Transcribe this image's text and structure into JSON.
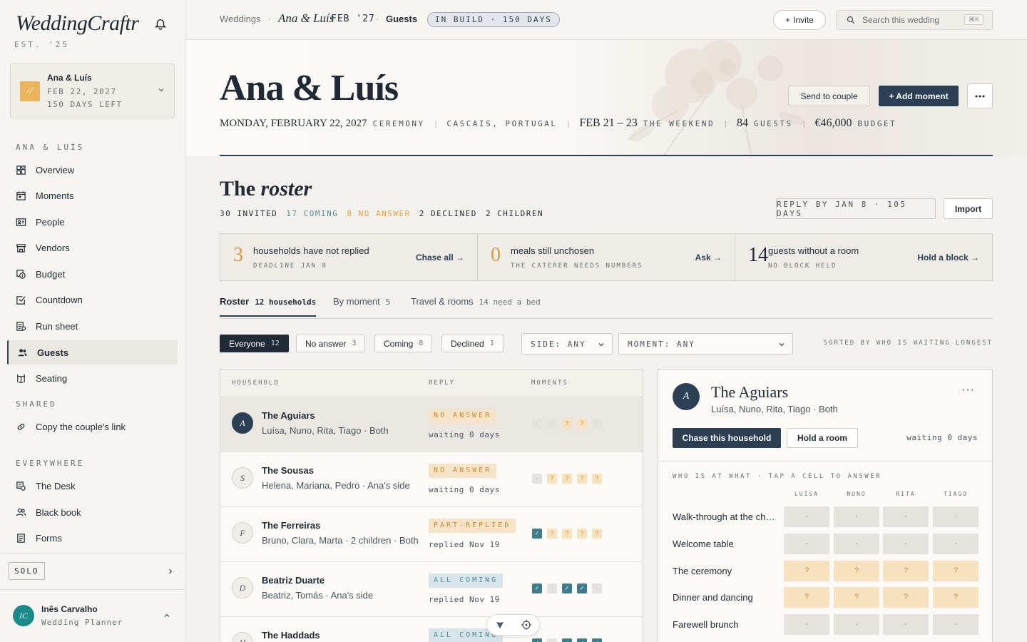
{
  "brand": {
    "name": "WeddingCraftr",
    "est": "EST. '25"
  },
  "wedding_selector": {
    "initials": "//",
    "couple": "Ana & Luís",
    "date": "FEB 22, 2027",
    "days_left": "150 DAYS LEFT"
  },
  "sidebar": {
    "section_couple": "ANA & LUÍS",
    "items": [
      {
        "label": "Overview",
        "icon": "grid-icon"
      },
      {
        "label": "Moments",
        "icon": "calendar-icon"
      },
      {
        "label": "People",
        "icon": "id-card-icon"
      },
      {
        "label": "Vendors",
        "icon": "storefront-icon"
      },
      {
        "label": "Budget",
        "icon": "coins-icon"
      },
      {
        "label": "Countdown",
        "icon": "checkbox-icon"
      },
      {
        "label": "Run sheet",
        "icon": "clipboard-icon"
      },
      {
        "label": "Guests",
        "icon": "users-icon",
        "active": true
      },
      {
        "label": "Seating",
        "icon": "table-icon"
      }
    ],
    "section_shared": "SHARED",
    "shared_link": "Copy the couple's link",
    "section_everywhere": "EVERYWHERE",
    "everywhere_items": [
      {
        "label": "The Desk",
        "icon": "desk-icon"
      },
      {
        "label": "Black book",
        "icon": "users-icon"
      },
      {
        "label": "Forms",
        "icon": "form-icon"
      }
    ],
    "plan": "SOLO",
    "user": {
      "initials": "IC",
      "name": "Inês Carvalho",
      "role": "Wedding Planner"
    }
  },
  "topbar": {
    "crumb1": "Weddings",
    "crumb2": "Ana & Luís",
    "crumb2b": "FEB '27",
    "crumb3": "Guests",
    "status_pill": "IN BUILD · 150 DAYS",
    "invite_label": "Invite",
    "search_placeholder": "Search this wedding",
    "search_shortcut": "⌘K"
  },
  "hero": {
    "title": "Ana & Luís",
    "date": "MONDAY, FEBRUARY 22, 2027",
    "date_tag": "CEREMONY",
    "location": "CASCAIS, PORTUGAL",
    "weekend": "FEB 21 – 23",
    "weekend_tag": "THE WEEKEND",
    "guests": "84",
    "guests_tag": "GUESTS",
    "budget": "€46,000",
    "budget_tag": "BUDGET",
    "send_label": "Send to couple",
    "add_label": "+ Add moment",
    "more_label": "···"
  },
  "roster": {
    "title_a": "The",
    "title_b": "roster",
    "counts": {
      "invited": "30 INVITED",
      "coming": "17 COMING",
      "no_answer": "8 NO ANSWER",
      "declined": "2 DECLINED",
      "children": "2 CHILDREN"
    },
    "reply_by": "REPLY BY JAN 8 · 105 DAYS",
    "import_label": "Import",
    "colors": {
      "coming": "#4f8c9a",
      "no_answer": "#e0a24a",
      "accent": "#2b3f55"
    },
    "alerts": [
      {
        "num": "3",
        "title": "households have not replied",
        "sub": "DEADLINE JAN 8",
        "action": "Chase all →",
        "color": "#d59a47"
      },
      {
        "num": "0",
        "title": "meals still unchosen",
        "sub": "THE CATERER NEEDS NUMBERS",
        "action": "Ask →",
        "color": "#d59a47"
      },
      {
        "num": "14",
        "title": "guests without a room",
        "sub": "NO BLOCK HELD",
        "action": "Hold a block →",
        "color": "#1f2a35"
      }
    ],
    "tabs": [
      {
        "label": "Roster",
        "count": "12 households",
        "active": true
      },
      {
        "label": "By moment",
        "count": "5"
      },
      {
        "label": "Travel & rooms",
        "count": "14 need a bed"
      }
    ],
    "filters": [
      {
        "label": "Everyone",
        "count": "12",
        "on": true
      },
      {
        "label": "No answer",
        "count": "3"
      },
      {
        "label": "Coming",
        "count": "8"
      },
      {
        "label": "Declined",
        "count": "1"
      }
    ],
    "side_select": "SIDE: ANY",
    "moment_select": "MOMENT: ANY",
    "sorted": "SORTED BY WHO IS WAITING LONGEST"
  },
  "table": {
    "headers": {
      "household": "HOUSEHOLD",
      "reply": "REPLY",
      "moments": "MOMENTS"
    },
    "rows": [
      {
        "initial": "A",
        "name": "The Aguiars",
        "members": "Luísa, Nuno, Rita, Tiago · Both",
        "status": "NO ANSWER",
        "kind": "no",
        "wait": "waiting 0 days",
        "moments": [
          "n",
          "n",
          "q",
          "q",
          "n"
        ],
        "selected": true
      },
      {
        "initial": "S",
        "name": "The Sousas",
        "members": "Helena, Mariana, Pedro · Ana's side",
        "status": "NO ANSWER",
        "kind": "no",
        "wait": "waiting 0 days",
        "moments": [
          "n",
          "q",
          "q",
          "q",
          "q"
        ]
      },
      {
        "initial": "F",
        "name": "The Ferreiras",
        "members": "Bruno, Clara, Marta · 2 children · Both",
        "status": "PART-REPLIED",
        "kind": "part",
        "wait": "replied Nov 19",
        "moments": [
          "y",
          "q",
          "q",
          "q",
          "q"
        ]
      },
      {
        "initial": "D",
        "name": "Beatriz Duarte",
        "members": "Beatriz, Tomás · Ana's side",
        "status": "ALL COMING",
        "kind": "all",
        "wait": "replied Nov 19",
        "moments": [
          "y",
          "n",
          "y",
          "y",
          "n"
        ]
      },
      {
        "initial": "H",
        "name": "The Haddads",
        "members": "",
        "status": "ALL COMING",
        "kind": "all",
        "wait": "",
        "moments": [
          "y",
          "n",
          "y",
          "y",
          "y"
        ]
      }
    ]
  },
  "panel": {
    "initial": "A",
    "title": "The Aguiars",
    "members": "Luísa, Nuno, Rita, Tiago · Both",
    "chase_label": "Chase this household",
    "room_label": "Hold a room",
    "wait": "waiting 0 days",
    "matrix_header": "WHO IS AT WHAT · TAP A CELL TO ANSWER",
    "people": [
      "LUÍSA",
      "NUNO",
      "RITA",
      "TIAGO"
    ],
    "moments": [
      {
        "label": "Walk-through at the church",
        "cells": [
          "·",
          "·",
          "·",
          "·"
        ],
        "kind": "n"
      },
      {
        "label": "Welcome table",
        "cells": [
          "·",
          "·",
          "·",
          "·"
        ],
        "kind": "n"
      },
      {
        "label": "The ceremony",
        "cells": [
          "?",
          "?",
          "?",
          "?"
        ],
        "kind": "q"
      },
      {
        "label": "Dinner and dancing",
        "cells": [
          "?",
          "?",
          "?",
          "?"
        ],
        "kind": "q"
      },
      {
        "label": "Farewell brunch",
        "cells": [
          "·",
          "·",
          "·",
          "·"
        ],
        "kind": "n"
      }
    ]
  }
}
